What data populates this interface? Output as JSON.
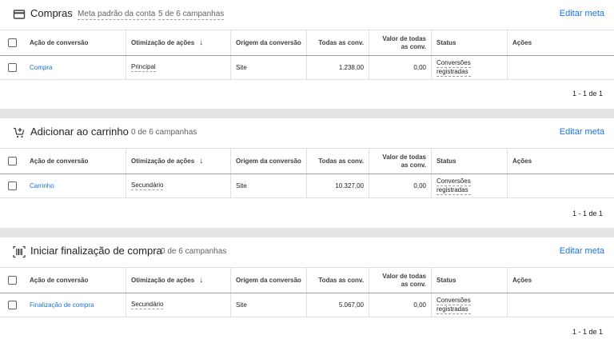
{
  "columns": {
    "acao": "Ação de conversão",
    "otim": "Otimização de ações",
    "orig": "Origem da conversão",
    "todas": "Todas as conv.",
    "valor_l1": "Valor de todas",
    "valor_l2": "as conv.",
    "status": "Status",
    "acoes": "Ações"
  },
  "edit_label": "Editar meta",
  "sections": [
    {
      "title": "Compras",
      "icon": "credit-card-icon",
      "meta_default": "Meta padrão da conta",
      "campaigns": "5 de 6 campanhas",
      "row": {
        "acao": "Compra",
        "otim": "Principal",
        "orig": "Site",
        "todas": "1.238,00",
        "valor": "0,00",
        "status_l1": "Conversões",
        "status_l2": "registradas"
      },
      "pager": "1 - 1 de 1"
    },
    {
      "title": "Adicionar ao carrinho",
      "icon": "add-shopping-cart-icon",
      "campaigns": "0 de 6 campanhas",
      "row": {
        "acao": "Carrinho",
        "otim": "Secundário",
        "orig": "Site",
        "todas": "10.327,00",
        "valor": "0,00",
        "status_l1": "Conversões",
        "status_l2": "registradas"
      },
      "pager": "1 - 1 de 1"
    },
    {
      "title": "Iniciar finalização de compra",
      "icon": "barcode-scanner-icon",
      "campaigns": "0 de 6 campanhas",
      "row": {
        "acao": "Finalização de compra",
        "otim": "Secundário",
        "orig": "Site",
        "todas": "5.067,00",
        "valor": "0,00",
        "status_l1": "Conversões",
        "status_l2": "registradas"
      },
      "pager": "1 - 1 de 1"
    }
  ],
  "colors": {
    "link": "#1a73e8",
    "text": "#202124",
    "muted": "#5f6368",
    "page_bg": "#e4e4e4"
  }
}
